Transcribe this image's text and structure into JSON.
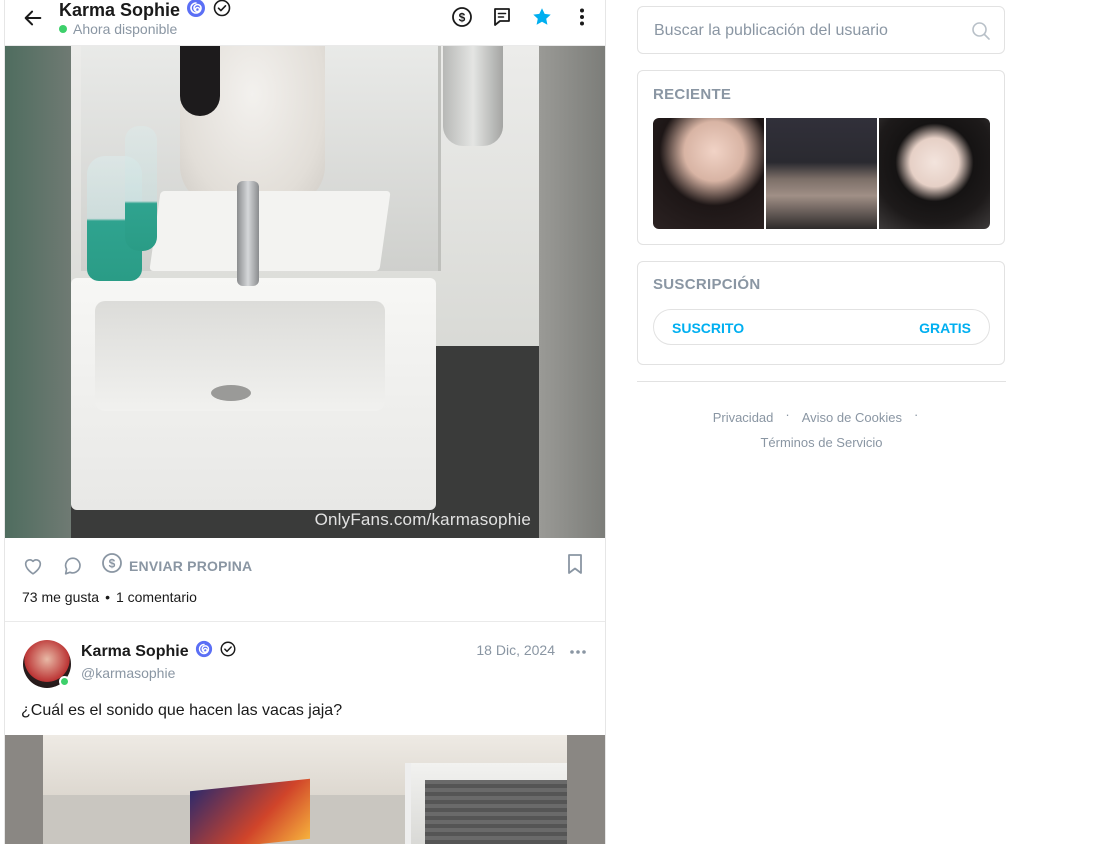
{
  "header": {
    "name": "Karma Sophie",
    "status": "Ahora disponible"
  },
  "post1": {
    "watermark": "OnlyFans.com/karmasophie",
    "tip_label": "ENVIAR PROPINA",
    "likes": "73 me gusta",
    "separator": "•",
    "comments": "1 comentario"
  },
  "post2": {
    "name": "Karma Sophie",
    "handle": "@karmasophie",
    "date": "18 Dic, 2024",
    "text": "¿Cuál es el sonido que hacen las vacas jaja?"
  },
  "sidebar": {
    "search_placeholder": "Buscar la publicación del usuario",
    "recent_title": "RECIENTE",
    "subscription_title": "SUSCRIPCIÓN",
    "subscribed_label": "SUSCRITO",
    "free_label": "GRATIS",
    "footer": {
      "privacy": "Privacidad",
      "cookies": "Aviso de Cookies",
      "terms": "Términos de Servicio",
      "dot": "·"
    }
  },
  "colors": {
    "accent": "#00aff0",
    "muted": "#8a96a3",
    "online": "#3dd06b"
  }
}
